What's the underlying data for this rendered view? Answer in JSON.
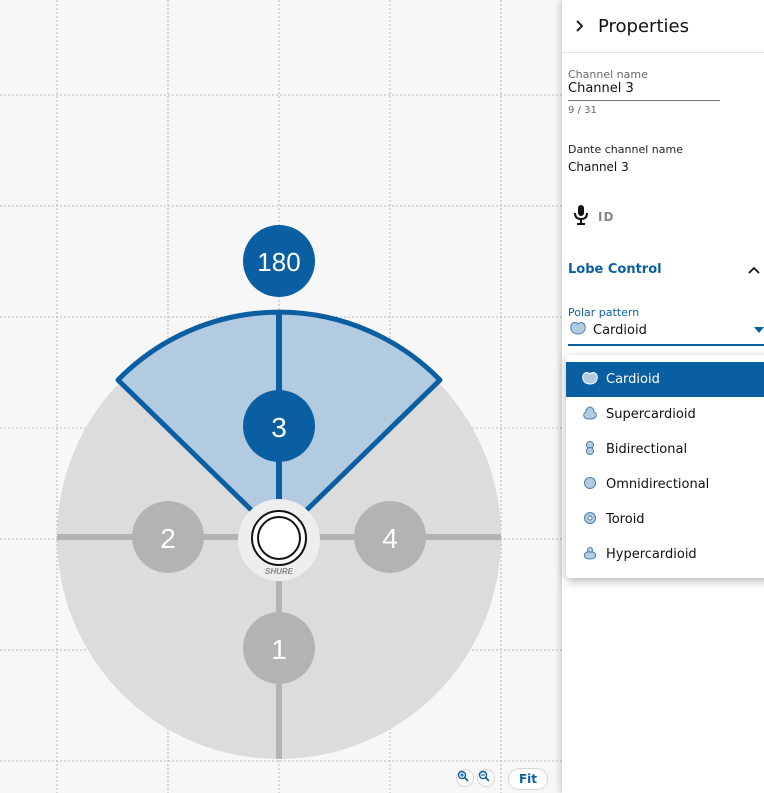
{
  "canvas": {
    "lobes": [
      {
        "number": "1",
        "state": "inactive"
      },
      {
        "number": "2",
        "state": "inactive"
      },
      {
        "number": "3",
        "state": "active"
      },
      {
        "number": "4",
        "state": "inactive"
      }
    ],
    "angle_badge": "180",
    "device_brand": "SHURE",
    "zoom_in_icon": "zoom-in-icon",
    "zoom_out_icon": "zoom-out-icon",
    "fit_label": "Fit"
  },
  "panel": {
    "header_icon": "chevron-right-icon",
    "title": "Properties",
    "channel_name": {
      "label": "Channel name",
      "value": "Channel 3",
      "counter": "9 / 31"
    },
    "dante_channel": {
      "label": "Dante channel name",
      "value": "Channel 3"
    },
    "id_icon": "microphone-icon",
    "id_label": "ID",
    "section": {
      "title": "Lobe Control",
      "toggle_icon": "chevron-up-icon"
    },
    "polar_pattern": {
      "label": "Polar pattern",
      "value": "Cardioid",
      "icon": "cardioid-icon"
    }
  },
  "dropdown": {
    "selected": "Cardioid",
    "options": [
      {
        "label": "Cardioid",
        "icon": "cardioid-icon"
      },
      {
        "label": "Supercardioid",
        "icon": "supercardioid-icon"
      },
      {
        "label": "Bidirectional",
        "icon": "bidirectional-icon"
      },
      {
        "label": "Omnidirectional",
        "icon": "omnidirectional-icon"
      },
      {
        "label": "Toroid",
        "icon": "toroid-icon"
      },
      {
        "label": "Hypercardioid",
        "icon": "hypercardioid-icon"
      }
    ]
  },
  "colors": {
    "accent": "#0a5fa3",
    "lobe_inactive": "#b3b3b3",
    "coverage": "#dcdcdc",
    "lobe_fill": "#b3cbe0",
    "grid": "#b8b8b8"
  }
}
